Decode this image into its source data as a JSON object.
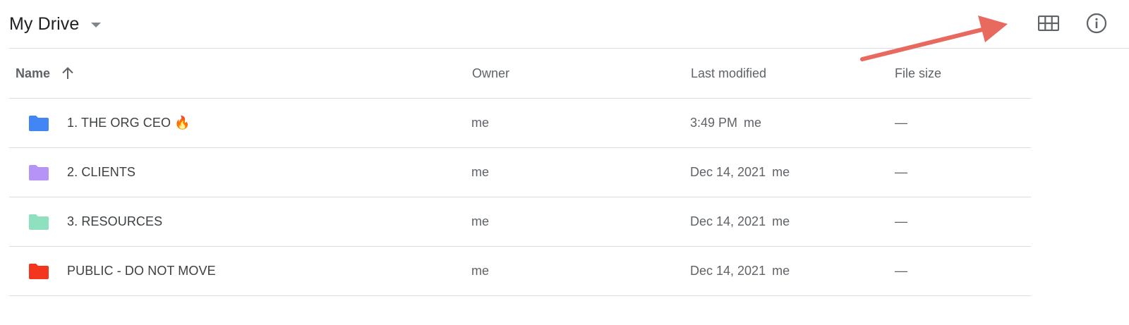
{
  "header": {
    "title": "My Drive",
    "grid_icon": "grid-view-icon",
    "info_icon": "info-icon"
  },
  "columns": {
    "name": "Name",
    "owner": "Owner",
    "last_modified": "Last modified",
    "file_size": "File size"
  },
  "rows": [
    {
      "name": "1. THE ORG CEO 🔥",
      "owner": "me",
      "modified": "3:49 PM",
      "modified_by": "me",
      "size": "—",
      "folder_color": "#4285f4"
    },
    {
      "name": "2. CLIENTS",
      "owner": "me",
      "modified": "Dec 14, 2021",
      "modified_by": "me",
      "size": "—",
      "folder_color": "#b694f7"
    },
    {
      "name": "3. RESOURCES",
      "owner": "me",
      "modified": "Dec 14, 2021",
      "modified_by": "me",
      "size": "—",
      "folder_color": "#8fe0bf"
    },
    {
      "name": "PUBLIC - DO NOT MOVE",
      "owner": "me",
      "modified": "Dec 14, 2021",
      "modified_by": "me",
      "size": "—",
      "folder_color": "#f4351d"
    }
  ],
  "colors": {
    "annotation_arrow": "#e8695d",
    "divider": "#dadce0",
    "secondary_text": "#5f6368"
  }
}
